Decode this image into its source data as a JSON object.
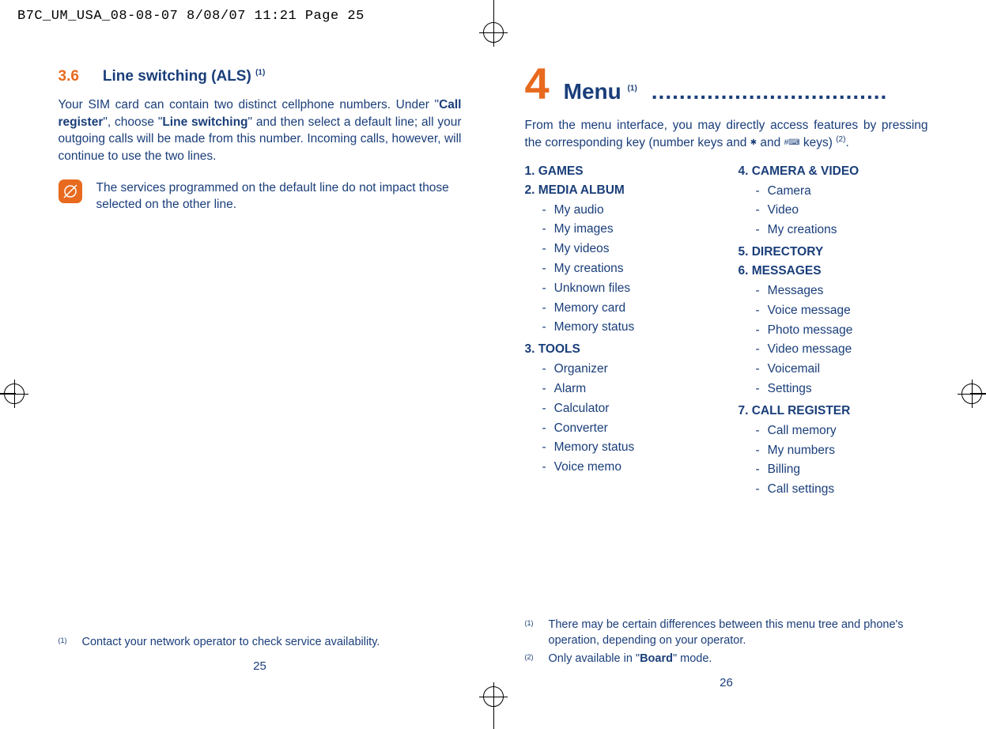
{
  "header": "B7C_UM_USA_08-08-07  8/08/07  11:21  Page 25",
  "left": {
    "section_num": "3.6",
    "section_title_a": "Line switching (ALS) ",
    "section_sup": "(1)",
    "para_parts": {
      "p1a": "Your SIM card can contain two distinct cellphone numbers. Under \"",
      "p1b": "Call register",
      "p1c": "\", choose \"",
      "p1d": "Line switching",
      "p1e": "\" and then select a default line; all your outgoing calls will be made from this number. Incoming calls, however, will continue to use the two lines."
    },
    "note": "The services programmed on the default line do not impact those selected on the other line.",
    "footnote_num": "(1)",
    "footnote": "Contact your network operator to check service availability.",
    "pagenum": "25"
  },
  "right": {
    "chapter_num": "4",
    "chapter_title": "Menu ",
    "chapter_sup": "(1)",
    "dots": "..................................",
    "intro_a": "From the menu interface, you may directly access features by pressing the corresponding key (number keys and ",
    "intro_b": " and ",
    "intro_c": " keys) ",
    "intro_sup": "(2)",
    "intro_d": ".",
    "menu": {
      "h1": "1. GAMES",
      "h2": "2. MEDIA ALBUM",
      "h2items": [
        "My audio",
        "My images",
        "My videos",
        "My creations",
        "Unknown files",
        "Memory card",
        "Memory status"
      ],
      "h3": "3. TOOLS",
      "h3items": [
        "Organizer",
        "Alarm",
        "Calculator",
        "Converter",
        "Memory status",
        "Voice memo"
      ],
      "h4": "4. CAMERA & VIDEO",
      "h4items": [
        "Camera",
        "Video",
        "My creations"
      ],
      "h5": "5. DIRECTORY",
      "h6": "6. MESSAGES",
      "h6items": [
        "Messages",
        "Voice message",
        "Photo message",
        "Video message",
        "Voicemail",
        "Settings"
      ],
      "h7": "7. CALL REGISTER",
      "h7items": [
        "Call memory",
        "My numbers",
        "Billing",
        "Call settings"
      ]
    },
    "fn1_num": "(1)",
    "fn1": "There may be certain differences between this menu tree and phone's operation, depending on your operator.",
    "fn2_num": "(2)",
    "fn2_a": "Only available in \"",
    "fn2_b": "Board",
    "fn2_c": "\" mode.",
    "pagenum": "26"
  }
}
